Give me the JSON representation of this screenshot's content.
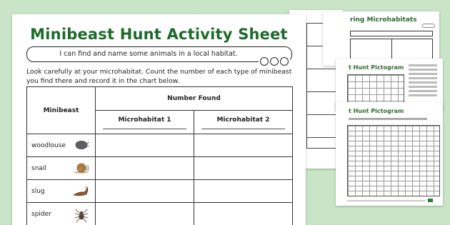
{
  "main_sheet": {
    "title": "Minibeast Hunt Activity Sheet",
    "objective": "I can find and name some animals in a local habitat.",
    "instructions": "Look carefully at your microhabitat. Count the number of each type of minibeast you find there and record it in the chart below.",
    "table": {
      "col_minibeast": "Minibeast",
      "col_number_found": "Number Found",
      "col_micro1": "Microhabitat 1",
      "col_micro2": "Microhabitat 2",
      "rows": [
        {
          "name": "woodlouse",
          "icon": "woodlouse-icon"
        },
        {
          "name": "snail",
          "icon": "snail-icon"
        },
        {
          "name": "slug",
          "icon": "slug-icon"
        },
        {
          "name": "spider",
          "icon": "spider-icon"
        }
      ]
    }
  },
  "sheet_r1": {
    "title": "ring Microhabitats"
  },
  "sheet_r2": {
    "title": "t Hunt Pictogram"
  },
  "sheet_r3": {
    "title": "t Hunt Pictogram"
  },
  "colors": {
    "background": "#c9e4c6",
    "title_green": "#1c6b2a"
  }
}
